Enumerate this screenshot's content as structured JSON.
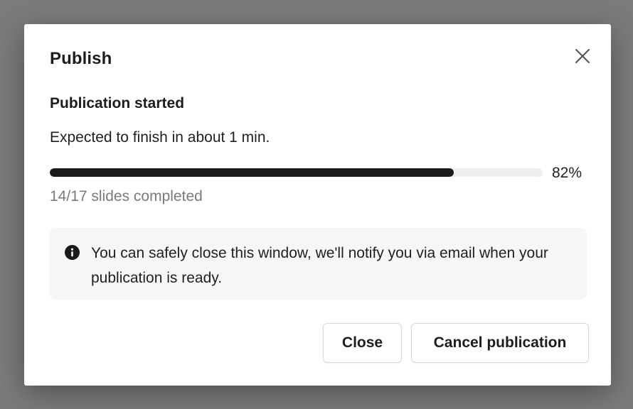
{
  "dialog": {
    "title": "Publish",
    "close_icon": "close-icon"
  },
  "status": {
    "heading": "Publication started",
    "expected": "Expected to finish in about 1 min.",
    "progress_percent": 82,
    "progress_label": "82%",
    "slides_completed": "14/17 slides completed"
  },
  "notice": {
    "icon": "info-icon",
    "text": "You can safely close this window, we'll notify you via email when your publication is ready."
  },
  "actions": {
    "close_label": "Close",
    "cancel_label": "Cancel publication"
  },
  "colors": {
    "progress_fill": "#1b1b1b",
    "progress_track": "#efefef",
    "notice_bg": "#f6f6f6",
    "backdrop": "#7b7b7b"
  }
}
